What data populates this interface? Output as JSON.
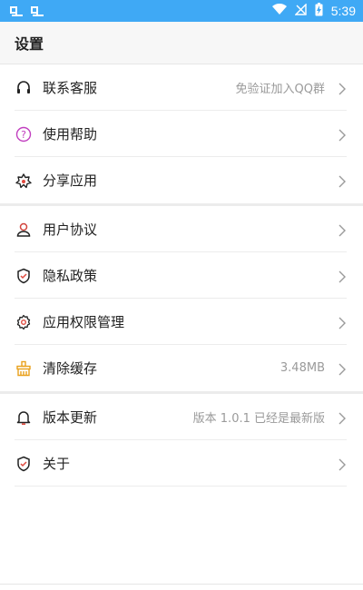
{
  "status_bar": {
    "left_icons": [
      "notification-app-icon",
      "notification-app-icon"
    ],
    "time": "5:39",
    "icons": [
      "wifi-icon",
      "no-signal-icon",
      "battery-charging-icon"
    ]
  },
  "header": {
    "title": "设置"
  },
  "groups": [
    {
      "items": [
        {
          "label": "联系客服",
          "value": "免验证加入QQ群",
          "icon": "headset-icon"
        },
        {
          "label": "使用帮助",
          "value": "",
          "icon": "help-icon"
        },
        {
          "label": "分享应用",
          "value": "",
          "icon": "share-icon"
        }
      ]
    },
    {
      "items": [
        {
          "label": "用户协议",
          "value": "",
          "icon": "user-icon"
        },
        {
          "label": "隐私政策",
          "value": "",
          "icon": "shield-icon"
        },
        {
          "label": "应用权限管理",
          "value": "",
          "icon": "gear-icon"
        },
        {
          "label": "清除缓存",
          "value": "3.48MB",
          "icon": "broom-icon"
        }
      ]
    },
    {
      "items": [
        {
          "label": "版本更新",
          "value": "版本 1.0.1 已经是最新版",
          "icon": "bell-icon"
        },
        {
          "label": "关于",
          "value": "",
          "icon": "shield-icon"
        }
      ]
    }
  ],
  "colors": {
    "status_bar": "#3fa9f5",
    "help_icon": "#c13fbf",
    "user_icon": "#d2453d",
    "broom_icon": "#e9a11c",
    "shield_check": "#e04a3f"
  }
}
